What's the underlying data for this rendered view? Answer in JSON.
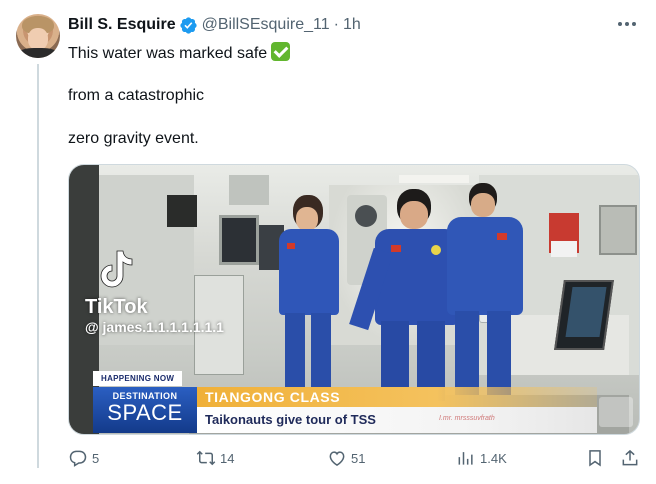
{
  "tweet": {
    "author_name": "Bill S. Esquire",
    "handle": "@BillSEsquire_11",
    "separator": "·",
    "time": "1h",
    "text_line1": "This water was marked safe",
    "text_line2": "from a catastrophic",
    "text_line3": "zero gravity event."
  },
  "media": {
    "tiktok_brand": "TikTok",
    "tiktok_user": "@ james.1.1.1.1.1.1.1",
    "happening_now": "HAPPENING NOW",
    "destination": "DESTINATION",
    "space": "SPACE",
    "class_title": "TIANGONG CLASS",
    "subtitle": "Taikonauts give tour of TSS",
    "watermark": "I.mr. mrsssuvfrath"
  },
  "actions": {
    "replies": "5",
    "reposts": "14",
    "likes": "51",
    "views": "1.4K"
  },
  "colors": {
    "verified": "#1d9bf0",
    "check_emoji": "#62b62f",
    "secondary_text": "#536471",
    "suit_blue": "#2f56b8"
  },
  "icons": [
    "verified-icon",
    "more-icon",
    "check-emoji-icon",
    "reply-icon",
    "repost-icon",
    "like-icon",
    "views-icon",
    "bookmark-icon",
    "share-icon"
  ]
}
